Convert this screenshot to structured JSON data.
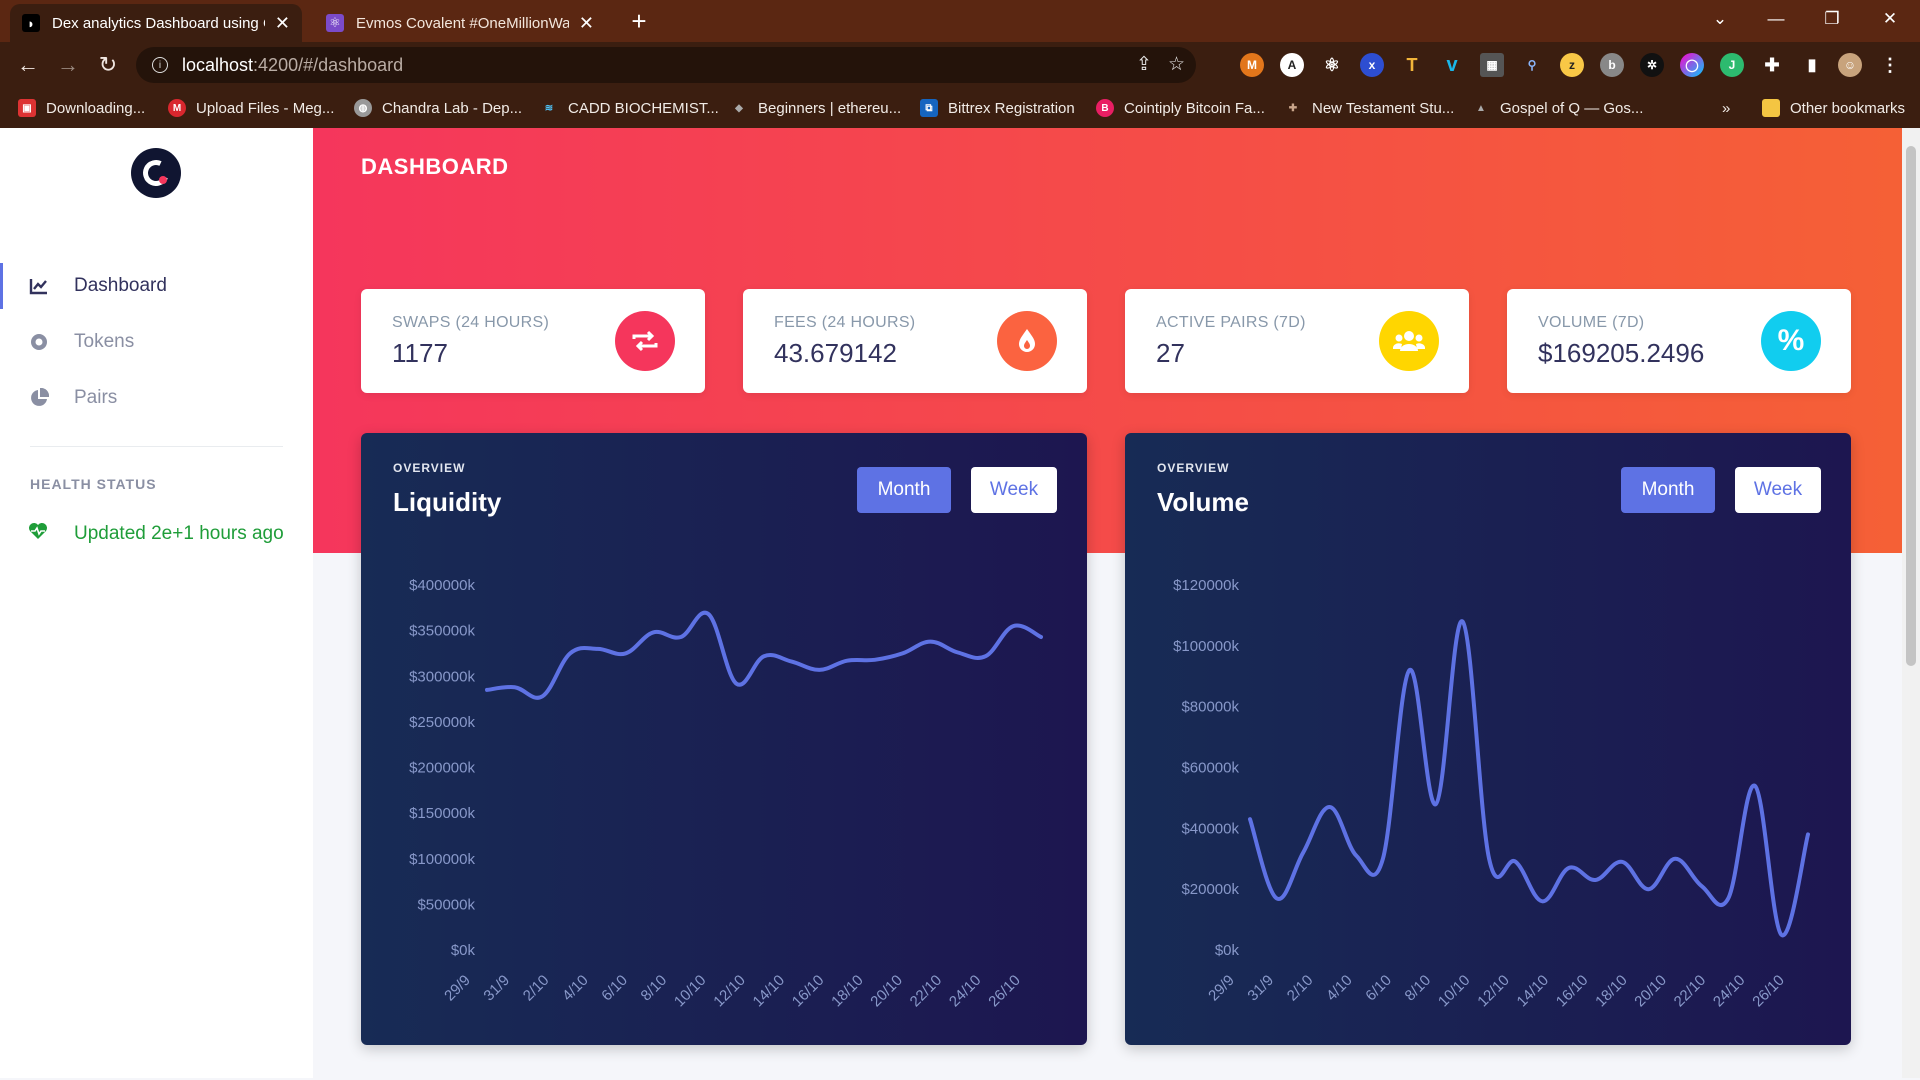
{
  "browser": {
    "tabs": [
      {
        "title": "Dex analytics Dashboard using C",
        "icon": "covalent-favicon",
        "active": true
      },
      {
        "title": "Evmos Covalent #OneMillionWall",
        "icon": "react-favicon",
        "active": false
      }
    ],
    "new_tab": "+",
    "url_host": "localhost",
    "url_path": ":4200/#/dashboard",
    "bookmarks": [
      "Downloading...",
      "Upload Files - Meg...",
      "Chandra Lab - Dep...",
      "CADD BIOCHEMIST...",
      "Beginners | ethereu...",
      "Bittrex Registration",
      "Cointiply Bitcoin Fa...",
      "New Testament Stu...",
      "Gospel of Q — Gos..."
    ],
    "bookmarks_overflow": "»",
    "other_bookmarks": "Other bookmarks"
  },
  "sidebar": {
    "items": [
      {
        "label": "Dashboard",
        "icon": "chart-line-icon",
        "active": true
      },
      {
        "label": "Tokens",
        "icon": "token-icon",
        "active": false
      },
      {
        "label": "Pairs",
        "icon": "pie-chart-icon",
        "active": false
      }
    ],
    "health_heading": "HEALTH STATUS",
    "health_status": "Updated 2e+1 hours ago"
  },
  "header": {
    "title": "DASHBOARD"
  },
  "stats": [
    {
      "label": "SWAPS (24 HOURS)",
      "value": "1177",
      "icon": "swap-arrows-icon",
      "color": "#f5365c"
    },
    {
      "label": "FEES (24 HOURS)",
      "value": "43.679142",
      "icon": "flame-icon",
      "color": "#fb6340"
    },
    {
      "label": "ACTIVE PAIRS (7D)",
      "value": "27",
      "icon": "users-icon",
      "color": "#ffd600"
    },
    {
      "label": "VOLUME (7D)",
      "value": "$169205.2496",
      "icon": "percent-icon",
      "color": "#11cdef"
    }
  ],
  "toggle_labels": {
    "month": "Month",
    "week": "Week"
  },
  "chart_data": [
    {
      "type": "line",
      "overline": "OVERVIEW",
      "title": "Liquidity",
      "ylim": [
        0,
        400000
      ],
      "yticks": [
        "$0k",
        "$50000k",
        "$100000k",
        "$150000k",
        "$200000k",
        "$250000k",
        "$300000k",
        "$350000k",
        "$400000k"
      ],
      "categories": [
        "29/9",
        "31/9",
        "2/10",
        "4/10",
        "6/10",
        "8/10",
        "10/10",
        "12/10",
        "14/10",
        "16/10",
        "18/10",
        "20/10",
        "22/10",
        "24/10",
        "26/10"
      ],
      "values": [
        285000,
        288000,
        278000,
        325000,
        330000,
        325000,
        348000,
        343000,
        368000,
        292000,
        322000,
        316000,
        307000,
        317000,
        318000,
        325000,
        338000,
        326000,
        322000,
        355000,
        343000
      ],
      "color": "#5e72e4",
      "grid": false,
      "legend": false
    },
    {
      "type": "line",
      "overline": "OVERVIEW",
      "title": "Volume",
      "ylim": [
        0,
        120000
      ],
      "yticks": [
        "$0k",
        "$20000k",
        "$40000k",
        "$60000k",
        "$80000k",
        "$100000k",
        "$120000k"
      ],
      "categories": [
        "29/9",
        "31/9",
        "2/10",
        "4/10",
        "6/10",
        "8/10",
        "10/10",
        "12/10",
        "14/10",
        "16/10",
        "18/10",
        "20/10",
        "22/10",
        "24/10",
        "26/10"
      ],
      "values": [
        43000,
        17000,
        32000,
        47000,
        31000,
        30000,
        92000,
        48000,
        108000,
        30000,
        29000,
        16000,
        27000,
        23000,
        29000,
        20000,
        30000,
        21000,
        17000,
        54000,
        5000,
        38000
      ],
      "color": "#5e72e4",
      "grid": false,
      "legend": false
    }
  ]
}
